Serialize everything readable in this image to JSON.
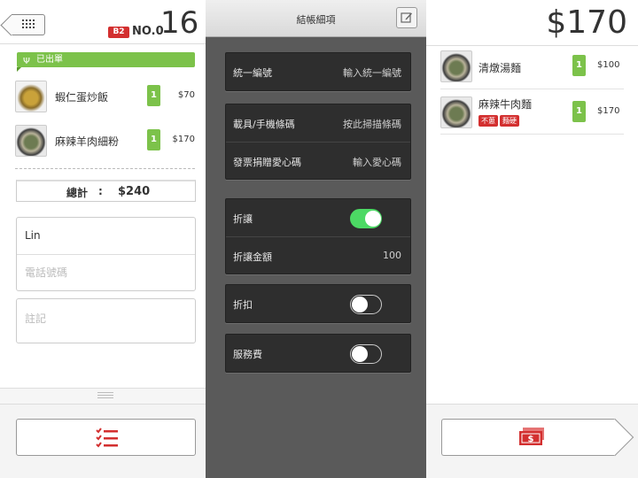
{
  "left": {
    "table_badge": "B2",
    "order_no_label": "NO.0",
    "order_count": "16",
    "status_label": "已出單",
    "items": [
      {
        "name": "蝦仁蛋炒飯",
        "qty": "1",
        "price": "$70",
        "icon": "fried-rice-thumbnail"
      },
      {
        "name": "麻辣羊肉細粉",
        "qty": "1",
        "price": "$170",
        "icon": "noodle-bowl-thumbnail"
      }
    ],
    "total_label": "總計",
    "total_colon": ":",
    "total_value": "$240",
    "customer_name": "Lin",
    "phone_placeholder": "電話號碼",
    "note_placeholder": "註記"
  },
  "middle": {
    "title": "結帳細項",
    "tax_id": {
      "label": "統一編號",
      "value": "輸入統一編號"
    },
    "carrier": {
      "label": "載具/手機條碼",
      "value": "按此掃描條碼"
    },
    "donation": {
      "label": "發票捐贈愛心碼",
      "value": "輸入愛心碼"
    },
    "discount": {
      "label": "折讓",
      "on": true
    },
    "discount_amount": {
      "label": "折讓金額",
      "value": "100"
    },
    "markdown": {
      "label": "折扣",
      "on": false
    },
    "service_fee": {
      "label": "服務費",
      "on": false
    }
  },
  "right": {
    "total": "$170",
    "items": [
      {
        "name": "清燉湯麵",
        "qty": "1",
        "price": "$100",
        "icon": "noodle-bowl-thumbnail",
        "tags": []
      },
      {
        "name": "麻辣牛肉麵",
        "qty": "1",
        "price": "$170",
        "icon": "noodle-bowl-thumbnail",
        "tags": [
          "不蔥",
          "麵硬"
        ]
      }
    ]
  },
  "colors": {
    "accent_green": "#7cc24a",
    "badge_red": "#d32f2f",
    "toggle_on": "#4cd964",
    "dark_panel": "#5a5a5a"
  }
}
